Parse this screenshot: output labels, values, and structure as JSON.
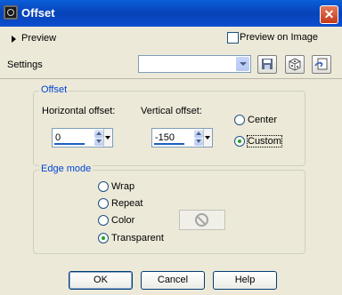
{
  "window": {
    "title": "Offset",
    "close_symbol": "✕"
  },
  "preview": {
    "label": "Preview",
    "preview_on_image_label": "Preview on Image",
    "preview_on_image_checked": false
  },
  "settings": {
    "label": "Settings",
    "selected_value": ""
  },
  "offset_group": {
    "title": "Offset",
    "horizontal_label": "Horizontal offset:",
    "horizontal_value": "0",
    "vertical_label": "Vertical offset:",
    "vertical_value": "-150",
    "options": [
      {
        "label": "Center",
        "checked": false
      },
      {
        "label": "Custom",
        "checked": true
      }
    ]
  },
  "edge_group": {
    "title": "Edge mode",
    "options": [
      {
        "label": "Wrap",
        "checked": false
      },
      {
        "label": "Repeat",
        "checked": false
      },
      {
        "label": "Color",
        "checked": false
      },
      {
        "label": "Transparent",
        "checked": true
      }
    ]
  },
  "buttons": {
    "ok": "OK",
    "cancel": "Cancel",
    "help": "Help"
  },
  "colors": {
    "title_bar": "#0a4ed0",
    "group_title": "#0046d5",
    "dialog_bg": "#ece9d8",
    "radio_checked": "#21a121"
  }
}
